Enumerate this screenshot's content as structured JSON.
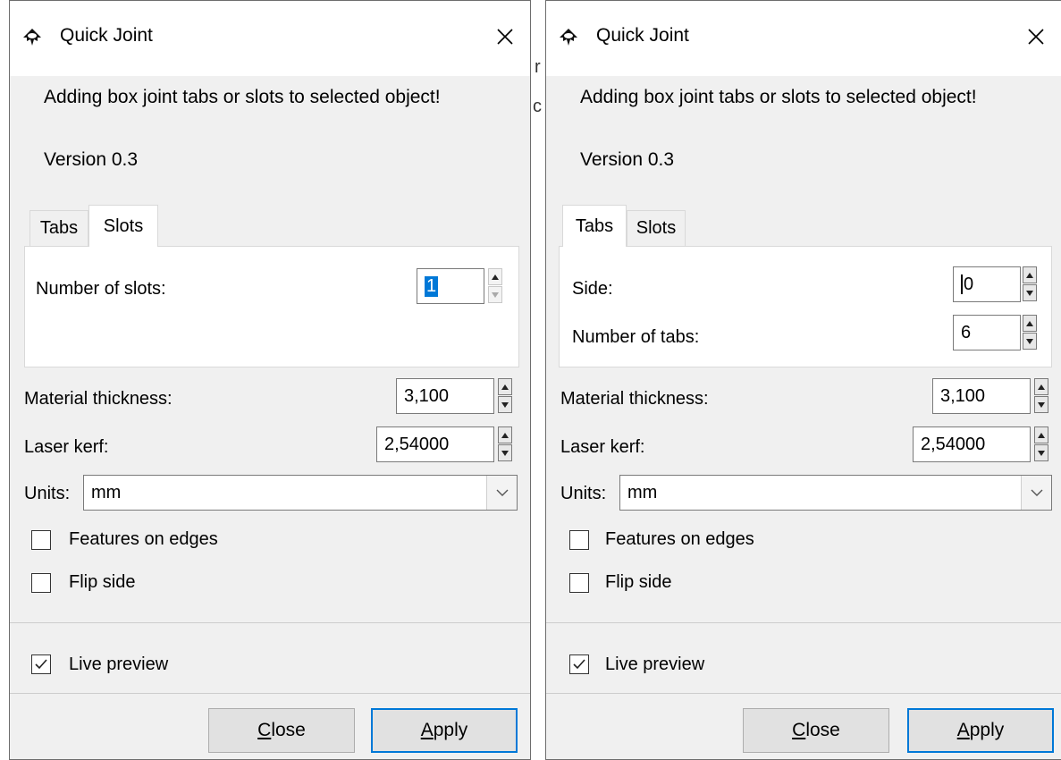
{
  "dialogs": [
    {
      "title": "Quick Joint",
      "description": "Adding box joint tabs or slots to selected object!",
      "version": "Version 0.3",
      "tabs": [
        {
          "label": "Tabs"
        },
        {
          "label": "Slots"
        }
      ],
      "active_tab": "Slots",
      "tab_fields": [
        {
          "label": "Number of slots:",
          "value": "1"
        }
      ],
      "material_thickness": {
        "label": "Material thickness:",
        "value": "3,100"
      },
      "laser_kerf": {
        "label": "Laser kerf:",
        "value": "2,54000"
      },
      "units": {
        "label": "Units:",
        "value": "mm"
      },
      "features_on_edges": {
        "label": "Features on edges",
        "checked": false
      },
      "flip_side": {
        "label": "Flip side",
        "checked": false
      },
      "live_preview": {
        "label": "Live preview",
        "checked": true
      },
      "buttons": {
        "close": {
          "mnemonic": "C",
          "rest": "lose"
        },
        "apply": {
          "mnemonic": "A",
          "rest": "pply"
        }
      }
    },
    {
      "title": "Quick Joint",
      "description": "Adding box joint tabs or slots to selected object!",
      "version": "Version 0.3",
      "tabs": [
        {
          "label": "Tabs"
        },
        {
          "label": "Slots"
        }
      ],
      "active_tab": "Tabs",
      "tab_fields": [
        {
          "label": "Side:",
          "value": "0"
        },
        {
          "label": "Number of tabs:",
          "value": "6"
        }
      ],
      "material_thickness": {
        "label": "Material thickness:",
        "value": "3,100"
      },
      "laser_kerf": {
        "label": "Laser kerf:",
        "value": "2,54000"
      },
      "units": {
        "label": "Units:",
        "value": "mm"
      },
      "features_on_edges": {
        "label": "Features on edges",
        "checked": false
      },
      "flip_side": {
        "label": "Flip side",
        "checked": false
      },
      "live_preview": {
        "label": "Live preview",
        "checked": true
      },
      "buttons": {
        "close": {
          "mnemonic": "C",
          "rest": "lose"
        },
        "apply": {
          "mnemonic": "A",
          "rest": "pply"
        }
      }
    }
  ],
  "background_fragments": [
    "r",
    "c"
  ],
  "colors": {
    "accent": "#0078d7",
    "dialog_bg": "#f0f0f0",
    "title_bg": "#ffffff"
  }
}
